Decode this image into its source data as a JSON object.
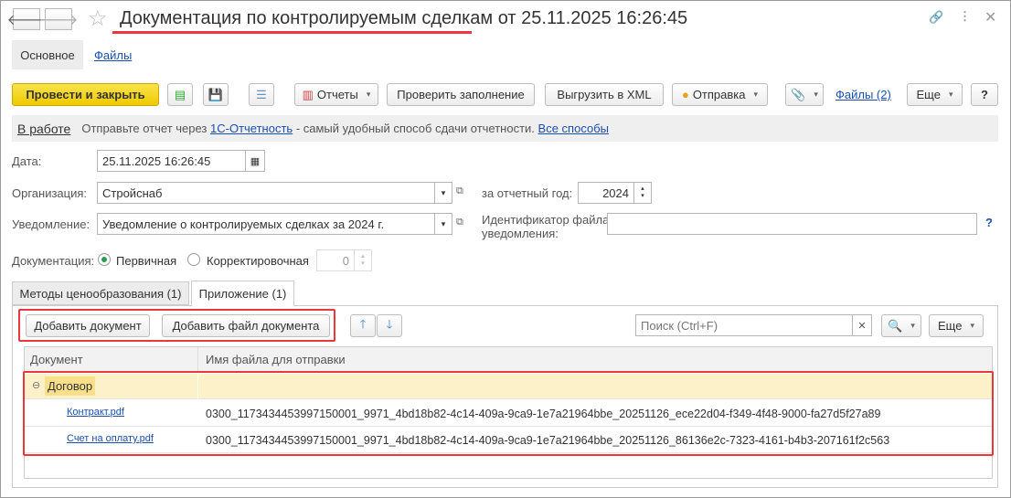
{
  "window": {
    "title": "Документация по контролируемым сделкам от 25.11.2025 16:26:45",
    "back_icon": "arrow-left-icon",
    "forward_icon": "arrow-right-icon",
    "star_icon": "star-icon",
    "link_icon": "link-icon",
    "more_icon": "vertical-dots-icon",
    "close_icon": "close-icon"
  },
  "sections": [
    {
      "label": "Основное"
    },
    {
      "label": "Файлы"
    }
  ],
  "toolbar": {
    "post_close": "Провести и закрыть",
    "reports": "Отчеты",
    "check": "Проверить заполнение",
    "export_xml": "Выгрузить в XML",
    "send": "Отправка",
    "files": "Файлы (2)",
    "more": "Еще",
    "help": "?"
  },
  "banner": {
    "status": "В работе",
    "text1": "Отправьте отчет через ",
    "link1": "1С-Отчетность",
    "text2": " - самый удобный способ сдачи отчетности. ",
    "link2": "Все способы"
  },
  "form": {
    "date_label": "Дата:",
    "date_value": "25.11.2025 16:26:45",
    "org_label": "Организация:",
    "org_value": "Стройснаб",
    "year_label": "за отчетный год:",
    "year_value": "2024",
    "notice_label": "Уведомление:",
    "notice_value": "Уведомление о контролируемых сделках за 2024 г.",
    "file_id_label": "Идентификатор файла уведомления:",
    "file_id_value": "",
    "help": "?",
    "doc_label": "Документация:",
    "radio_primary": "Первичная",
    "radio_corrective": "Корректировочная",
    "correction_value": "0",
    "selected": "primary"
  },
  "tabs": [
    {
      "label": "Методы ценообразования (1)",
      "active": false
    },
    {
      "label": "Приложение (1)",
      "active": true
    }
  ],
  "table_toolbar": {
    "add_doc": "Добавить документ",
    "add_file": "Добавить файл документа",
    "search_placeholder": "Поиск (Ctrl+F)",
    "more": "Еще"
  },
  "table": {
    "columns": [
      "Документ",
      "Имя файла для отправки"
    ],
    "group": "Договор",
    "rows": [
      {
        "doc": "Контракт.pdf",
        "file": "0300_1173434453997150001_9971_4bd18b82-4c14-409a-9ca9-1e7a21964bbe_20251126_ece22d04-f349-4f48-9000-fa27d5f27a89"
      },
      {
        "doc": "Счет на оплату.pdf",
        "file": "0300_1173434453997150001_9971_4bd18b82-4c14-409a-9ca9-1e7a21964bbe_20251126_86136e2c-7323-4161-b4b3-207161f2c563"
      }
    ]
  },
  "colors": {
    "accent_yellow": "#f5d20d",
    "highlight": "#e8383d",
    "group_row": "#fcf1c8",
    "link": "#1a4fb0"
  }
}
